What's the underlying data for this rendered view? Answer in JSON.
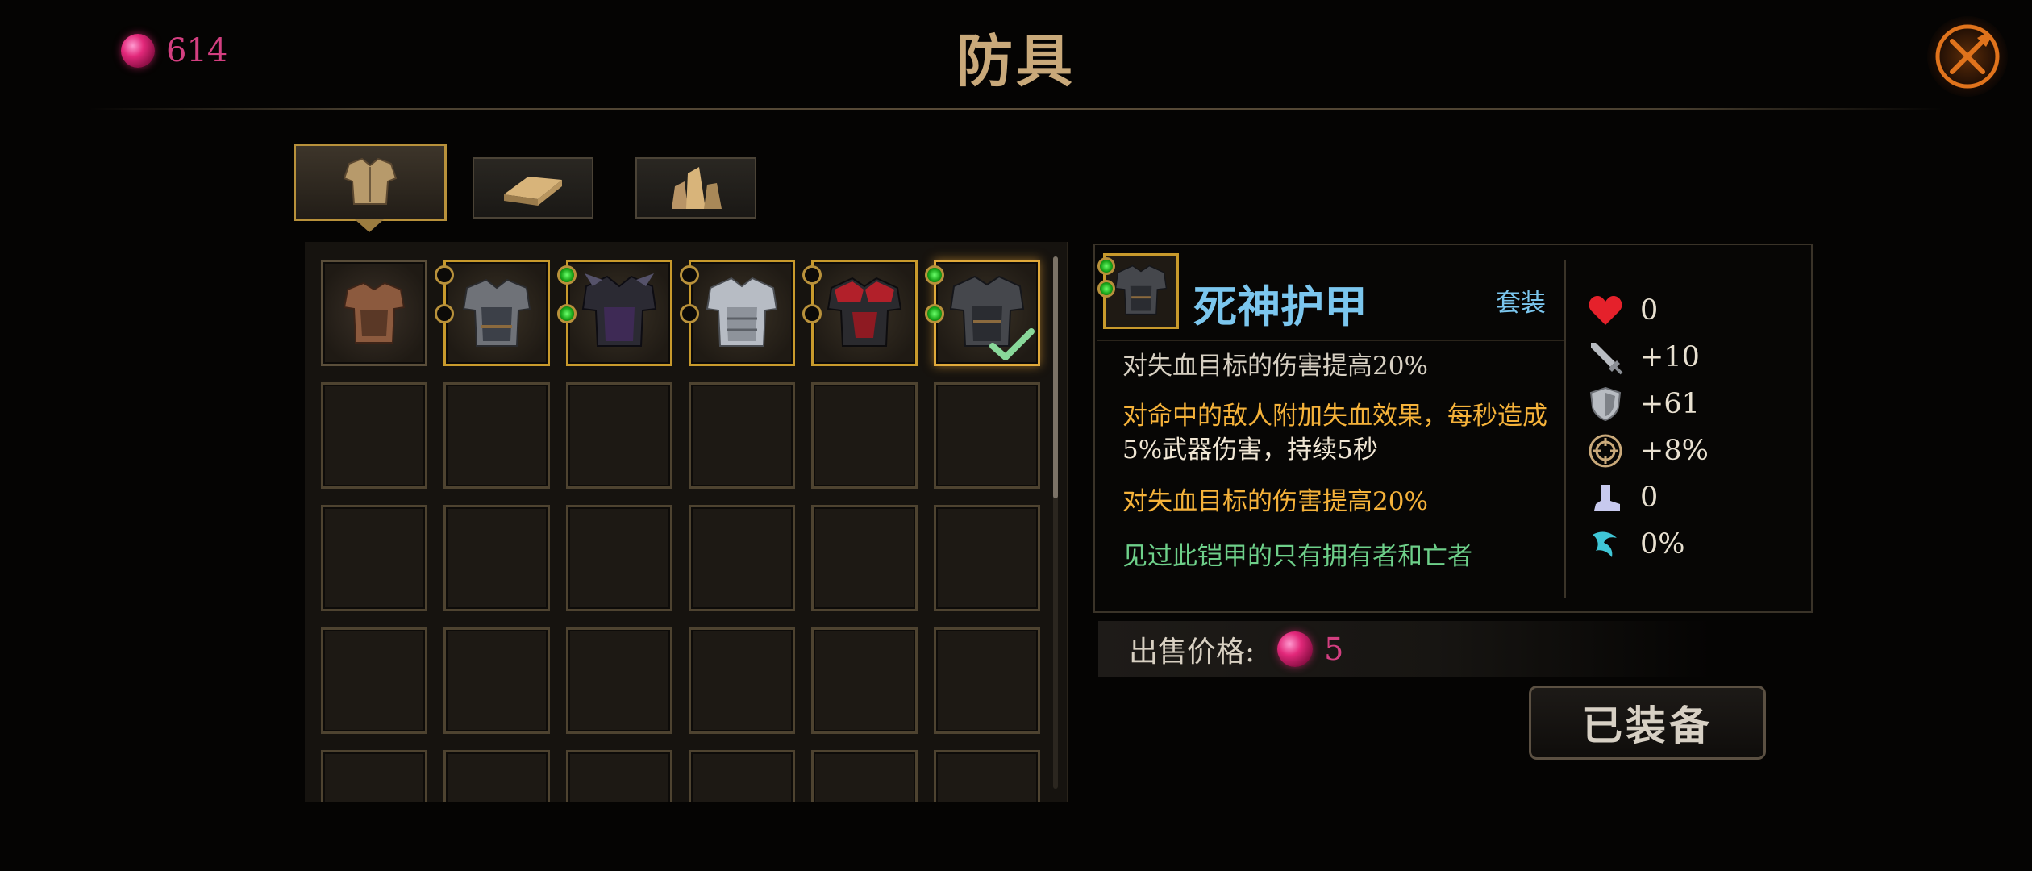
{
  "header": {
    "title": "防具",
    "currency_value": "614",
    "currency_icon": "gem-icon",
    "close_icon": "close-icon"
  },
  "tabs": [
    {
      "name": "armor",
      "icon": "armor-icon",
      "active": true
    },
    {
      "name": "material",
      "icon": "ingot-icon",
      "active": false
    },
    {
      "name": "crystal",
      "icon": "crystal-icon",
      "active": false
    }
  ],
  "inventory": {
    "columns": 6,
    "visible_rows": 5,
    "items": [
      {
        "slot": 1,
        "icon": "leather-armor-icon",
        "sockets": []
      },
      {
        "slot": 2,
        "icon": "steel-armor-icon",
        "sockets": [
          "empty",
          "empty"
        ]
      },
      {
        "slot": 3,
        "icon": "dark-armor-icon",
        "sockets": [
          "green",
          "green"
        ]
      },
      {
        "slot": 4,
        "icon": "silver-armor-icon",
        "sockets": [
          "empty",
          "empty"
        ]
      },
      {
        "slot": 5,
        "icon": "red-armor-icon",
        "sockets": [
          "empty",
          "empty"
        ]
      },
      {
        "slot": 6,
        "icon": "reaper-armor-icon",
        "sockets": [
          "green",
          "green"
        ],
        "equipped": true
      }
    ]
  },
  "detail": {
    "name": "死神护甲",
    "set_label": "套装",
    "descriptions": {
      "line1": "对失血目标的伤害提高20%",
      "line2a": "对命中的敌人附加失血效果，每秒造成",
      "line2b": "5%武器伤害，持续5秒",
      "line3": "对失血目标的伤害提高20%",
      "flavor": "见过此铠甲的只有拥有者和亡者"
    },
    "stats": [
      {
        "icon": "heart-icon",
        "value": "0"
      },
      {
        "icon": "sword-icon",
        "value": "+10"
      },
      {
        "icon": "shield-icon",
        "value": "+61"
      },
      {
        "icon": "crit-icon",
        "value": "+8%"
      },
      {
        "icon": "boot-icon",
        "value": "0"
      },
      {
        "icon": "evade-icon",
        "value": "0%"
      }
    ],
    "colors": {
      "name": "#7bc6ee",
      "yellow": "#f5b23a",
      "green": "#6ed08a"
    }
  },
  "sell": {
    "label": "出售价格:",
    "value": "5"
  },
  "equip_button": "已装备"
}
